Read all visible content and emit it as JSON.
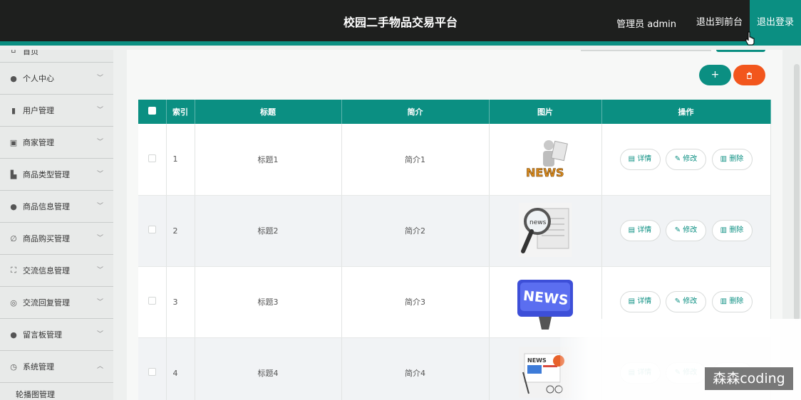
{
  "header": {
    "title": "校园二手物品交易平台",
    "admin_label": "管理员 admin",
    "back_front": "退出到前台",
    "logout": "退出登录"
  },
  "sidebar": {
    "home": "首页",
    "items": [
      {
        "label": "个人中心",
        "icon": "user-icon"
      },
      {
        "label": "用户管理",
        "icon": "bar-chart-icon"
      },
      {
        "label": "商家管理",
        "icon": "clipboard-icon"
      },
      {
        "label": "商品类型管理",
        "icon": "thumbs-up-icon"
      },
      {
        "label": "商品信息管理",
        "icon": "user-icon"
      },
      {
        "label": "商品购买管理",
        "icon": "no-icon"
      },
      {
        "label": "交流信息管理",
        "icon": "fullscreen-icon"
      },
      {
        "label": "交流回复管理",
        "icon": "compass-icon"
      },
      {
        "label": "留言板管理",
        "icon": "lightbulb-icon"
      },
      {
        "label": "系统管理",
        "icon": "clock-icon"
      }
    ],
    "submenu": "轮播图管理"
  },
  "toolbar": {
    "add_icon": "+",
    "delete_icon": "trash-icon"
  },
  "table": {
    "columns": [
      "索引",
      "标题",
      "简介",
      "图片",
      "操作"
    ],
    "rows": [
      {
        "index": "1",
        "title": "标题1",
        "intro": "简介1",
        "image": "news-man-image"
      },
      {
        "index": "2",
        "title": "标题2",
        "intro": "简介2",
        "image": "magnifier-news-image"
      },
      {
        "index": "3",
        "title": "标题3",
        "intro": "简介3",
        "image": "news-key-image"
      },
      {
        "index": "4",
        "title": "标题4",
        "intro": "简介4",
        "image": "newspaper-image"
      }
    ],
    "actions": {
      "detail": "详情",
      "edit": "修改",
      "delete": "删除"
    }
  },
  "watermark": "森森coding",
  "colors": {
    "accent": "#0b8f82",
    "danger": "#f2561d",
    "header_bg": "#1e1f1e"
  }
}
